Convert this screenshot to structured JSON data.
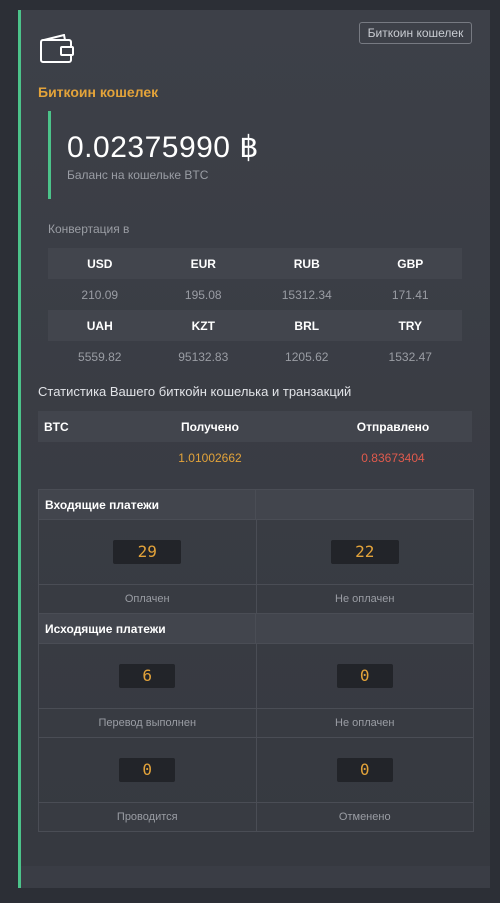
{
  "header": {
    "tag": "Биткоин кошелек",
    "title": "Биткоин кошелек"
  },
  "balance": {
    "amount": "0.02375990 ฿",
    "label": "Баланс на кошельке BTC"
  },
  "conversion": {
    "label": "Конвертация в",
    "rows": [
      {
        "currencies": [
          "USD",
          "EUR",
          "RUB",
          "GBP"
        ],
        "values": [
          "210.09",
          "195.08",
          "15312.34",
          "171.41"
        ]
      },
      {
        "currencies": [
          "UAH",
          "KZT",
          "BRL",
          "TRY"
        ],
        "values": [
          "5559.82",
          "95132.83",
          "1205.62",
          "1532.47"
        ]
      }
    ]
  },
  "stats": {
    "label": "Статистика Вашего биткойн кошелька и транзакций",
    "headers": [
      "BTC",
      "Получено",
      "Отправлено"
    ],
    "received": "1.01002662",
    "sent": "0.83673404"
  },
  "incoming": {
    "title": "Входящие платежи",
    "items": [
      {
        "value": "29",
        "label": "Оплачен"
      },
      {
        "value": "22",
        "label": "Не оплачен"
      }
    ]
  },
  "outgoing": {
    "title": "Исходящие платежи",
    "items": [
      {
        "value": "6",
        "label": "Перевод выполнен"
      },
      {
        "value": "0",
        "label": "Не оплачен"
      },
      {
        "value": "0",
        "label": "Проводится"
      },
      {
        "value": "0",
        "label": "Отменено"
      }
    ]
  },
  "colors": {
    "accent": "#e3a33a",
    "green": "#4cc38a",
    "sent": "#e05a4d"
  },
  "icons": {
    "wallet": "wallet-icon"
  }
}
